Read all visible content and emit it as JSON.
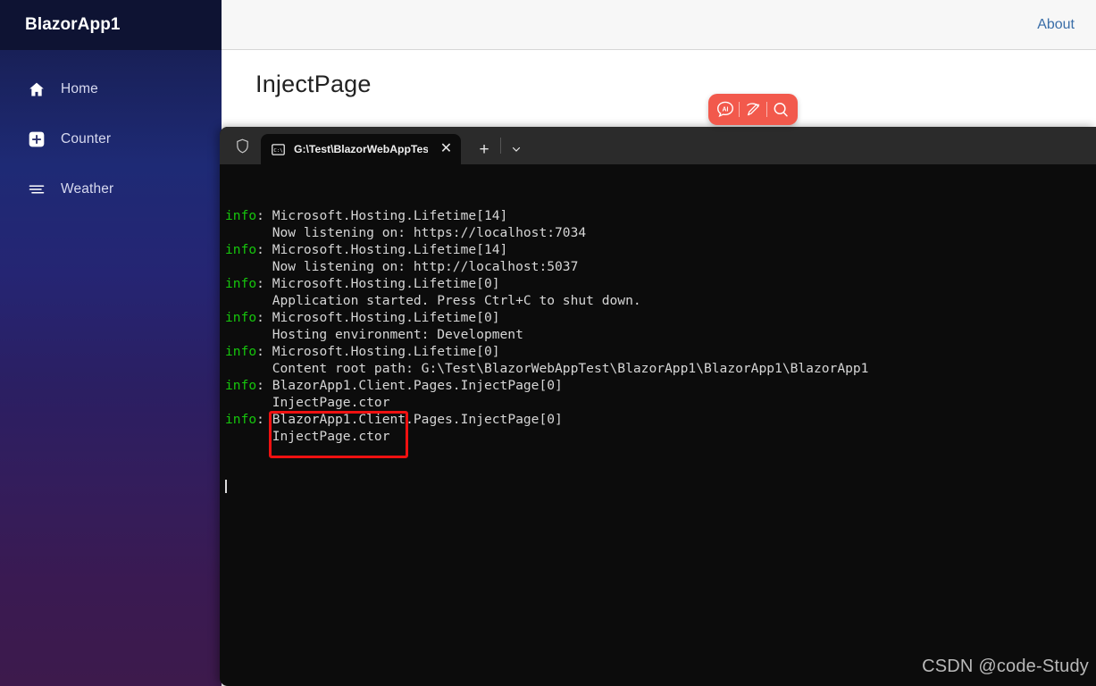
{
  "sidebar": {
    "brand": "BlazorApp1",
    "items": [
      {
        "label": "Home",
        "icon": "home-icon"
      },
      {
        "label": "Counter",
        "icon": "plus-square-icon"
      },
      {
        "label": "Weather",
        "icon": "list-lines-icon"
      }
    ]
  },
  "topbar": {
    "about_label": "About"
  },
  "page": {
    "title": "InjectPage"
  },
  "ai_toolbar": {
    "buttons": [
      {
        "name": "ai-assistant-icon",
        "label": "AI"
      },
      {
        "name": "magic-pen-icon",
        "label": ""
      },
      {
        "name": "search-icon",
        "label": ""
      }
    ]
  },
  "terminal": {
    "shield_icon": "shield-icon",
    "tab": {
      "icon": "console-cmd-icon",
      "title": "G:\\Test\\BlazorWebAppTest\\Bla",
      "close_label": "✕"
    },
    "new_tab_label": "+",
    "dropdown_label": "⌄",
    "lines": [
      {
        "prefix": "info",
        "text": ": Microsoft.Hosting.Lifetime[14]"
      },
      {
        "prefix": "",
        "text": "      Now listening on: https://localhost:7034"
      },
      {
        "prefix": "info",
        "text": ": Microsoft.Hosting.Lifetime[14]"
      },
      {
        "prefix": "",
        "text": "      Now listening on: http://localhost:5037"
      },
      {
        "prefix": "info",
        "text": ": Microsoft.Hosting.Lifetime[0]"
      },
      {
        "prefix": "",
        "text": "      Application started. Press Ctrl+C to shut down."
      },
      {
        "prefix": "info",
        "text": ": Microsoft.Hosting.Lifetime[0]"
      },
      {
        "prefix": "",
        "text": "      Hosting environment: Development"
      },
      {
        "prefix": "info",
        "text": ": Microsoft.Hosting.Lifetime[0]"
      },
      {
        "prefix": "",
        "text": "      Content root path: G:\\Test\\BlazorWebAppTest\\BlazorApp1\\BlazorApp1\\BlazorApp1"
      },
      {
        "prefix": "info",
        "text": ": BlazorApp1.Client.Pages.InjectPage[0]"
      },
      {
        "prefix": "",
        "text": "      InjectPage.ctor"
      },
      {
        "prefix": "info",
        "text": ": BlazorApp1.Client.Pages.InjectPage[0]"
      },
      {
        "prefix": "",
        "text": "      InjectPage.ctor"
      }
    ]
  },
  "watermark": {
    "text": "CSDN @code-Study"
  },
  "colors": {
    "accent_red": "#f2594c",
    "highlight_red": "#ef1111",
    "info_green": "#16c60c",
    "link_blue": "#3a6ea8",
    "sidebar_top": "#0e1333"
  }
}
